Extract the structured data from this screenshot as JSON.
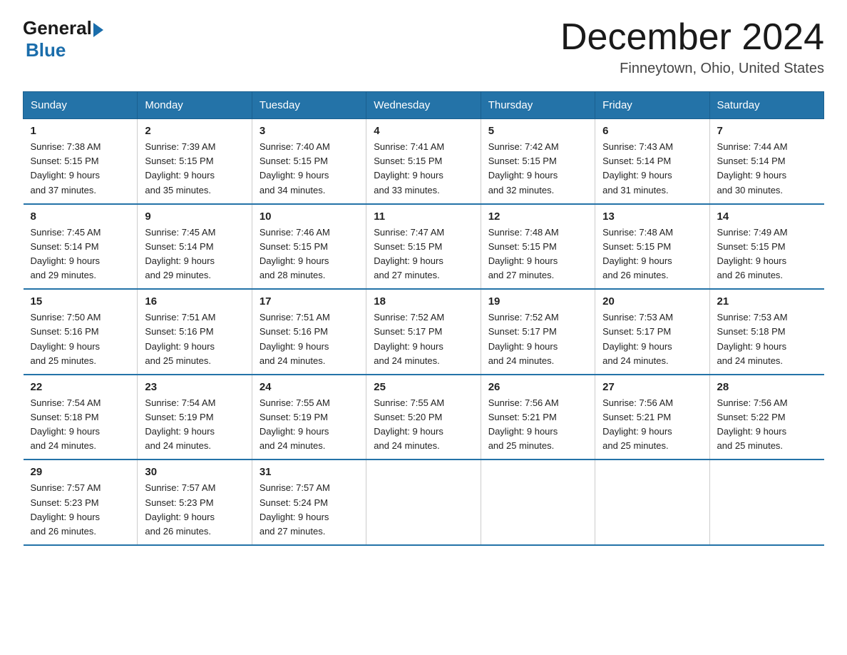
{
  "header": {
    "logo_general": "General",
    "logo_blue": "Blue",
    "title": "December 2024",
    "location": "Finneytown, Ohio, United States"
  },
  "days_of_week": [
    "Sunday",
    "Monday",
    "Tuesday",
    "Wednesday",
    "Thursday",
    "Friday",
    "Saturday"
  ],
  "weeks": [
    [
      {
        "day": "1",
        "sunrise": "7:38 AM",
        "sunset": "5:15 PM",
        "daylight": "9 hours and 37 minutes."
      },
      {
        "day": "2",
        "sunrise": "7:39 AM",
        "sunset": "5:15 PM",
        "daylight": "9 hours and 35 minutes."
      },
      {
        "day": "3",
        "sunrise": "7:40 AM",
        "sunset": "5:15 PM",
        "daylight": "9 hours and 34 minutes."
      },
      {
        "day": "4",
        "sunrise": "7:41 AM",
        "sunset": "5:15 PM",
        "daylight": "9 hours and 33 minutes."
      },
      {
        "day": "5",
        "sunrise": "7:42 AM",
        "sunset": "5:15 PM",
        "daylight": "9 hours and 32 minutes."
      },
      {
        "day": "6",
        "sunrise": "7:43 AM",
        "sunset": "5:14 PM",
        "daylight": "9 hours and 31 minutes."
      },
      {
        "day": "7",
        "sunrise": "7:44 AM",
        "sunset": "5:14 PM",
        "daylight": "9 hours and 30 minutes."
      }
    ],
    [
      {
        "day": "8",
        "sunrise": "7:45 AM",
        "sunset": "5:14 PM",
        "daylight": "9 hours and 29 minutes."
      },
      {
        "day": "9",
        "sunrise": "7:45 AM",
        "sunset": "5:14 PM",
        "daylight": "9 hours and 29 minutes."
      },
      {
        "day": "10",
        "sunrise": "7:46 AM",
        "sunset": "5:15 PM",
        "daylight": "9 hours and 28 minutes."
      },
      {
        "day": "11",
        "sunrise": "7:47 AM",
        "sunset": "5:15 PM",
        "daylight": "9 hours and 27 minutes."
      },
      {
        "day": "12",
        "sunrise": "7:48 AM",
        "sunset": "5:15 PM",
        "daylight": "9 hours and 27 minutes."
      },
      {
        "day": "13",
        "sunrise": "7:48 AM",
        "sunset": "5:15 PM",
        "daylight": "9 hours and 26 minutes."
      },
      {
        "day": "14",
        "sunrise": "7:49 AM",
        "sunset": "5:15 PM",
        "daylight": "9 hours and 26 minutes."
      }
    ],
    [
      {
        "day": "15",
        "sunrise": "7:50 AM",
        "sunset": "5:16 PM",
        "daylight": "9 hours and 25 minutes."
      },
      {
        "day": "16",
        "sunrise": "7:51 AM",
        "sunset": "5:16 PM",
        "daylight": "9 hours and 25 minutes."
      },
      {
        "day": "17",
        "sunrise": "7:51 AM",
        "sunset": "5:16 PM",
        "daylight": "9 hours and 24 minutes."
      },
      {
        "day": "18",
        "sunrise": "7:52 AM",
        "sunset": "5:17 PM",
        "daylight": "9 hours and 24 minutes."
      },
      {
        "day": "19",
        "sunrise": "7:52 AM",
        "sunset": "5:17 PM",
        "daylight": "9 hours and 24 minutes."
      },
      {
        "day": "20",
        "sunrise": "7:53 AM",
        "sunset": "5:17 PM",
        "daylight": "9 hours and 24 minutes."
      },
      {
        "day": "21",
        "sunrise": "7:53 AM",
        "sunset": "5:18 PM",
        "daylight": "9 hours and 24 minutes."
      }
    ],
    [
      {
        "day": "22",
        "sunrise": "7:54 AM",
        "sunset": "5:18 PM",
        "daylight": "9 hours and 24 minutes."
      },
      {
        "day": "23",
        "sunrise": "7:54 AM",
        "sunset": "5:19 PM",
        "daylight": "9 hours and 24 minutes."
      },
      {
        "day": "24",
        "sunrise": "7:55 AM",
        "sunset": "5:19 PM",
        "daylight": "9 hours and 24 minutes."
      },
      {
        "day": "25",
        "sunrise": "7:55 AM",
        "sunset": "5:20 PM",
        "daylight": "9 hours and 24 minutes."
      },
      {
        "day": "26",
        "sunrise": "7:56 AM",
        "sunset": "5:21 PM",
        "daylight": "9 hours and 25 minutes."
      },
      {
        "day": "27",
        "sunrise": "7:56 AM",
        "sunset": "5:21 PM",
        "daylight": "9 hours and 25 minutes."
      },
      {
        "day": "28",
        "sunrise": "7:56 AM",
        "sunset": "5:22 PM",
        "daylight": "9 hours and 25 minutes."
      }
    ],
    [
      {
        "day": "29",
        "sunrise": "7:57 AM",
        "sunset": "5:23 PM",
        "daylight": "9 hours and 26 minutes."
      },
      {
        "day": "30",
        "sunrise": "7:57 AM",
        "sunset": "5:23 PM",
        "daylight": "9 hours and 26 minutes."
      },
      {
        "day": "31",
        "sunrise": "7:57 AM",
        "sunset": "5:24 PM",
        "daylight": "9 hours and 27 minutes."
      },
      null,
      null,
      null,
      null
    ]
  ]
}
